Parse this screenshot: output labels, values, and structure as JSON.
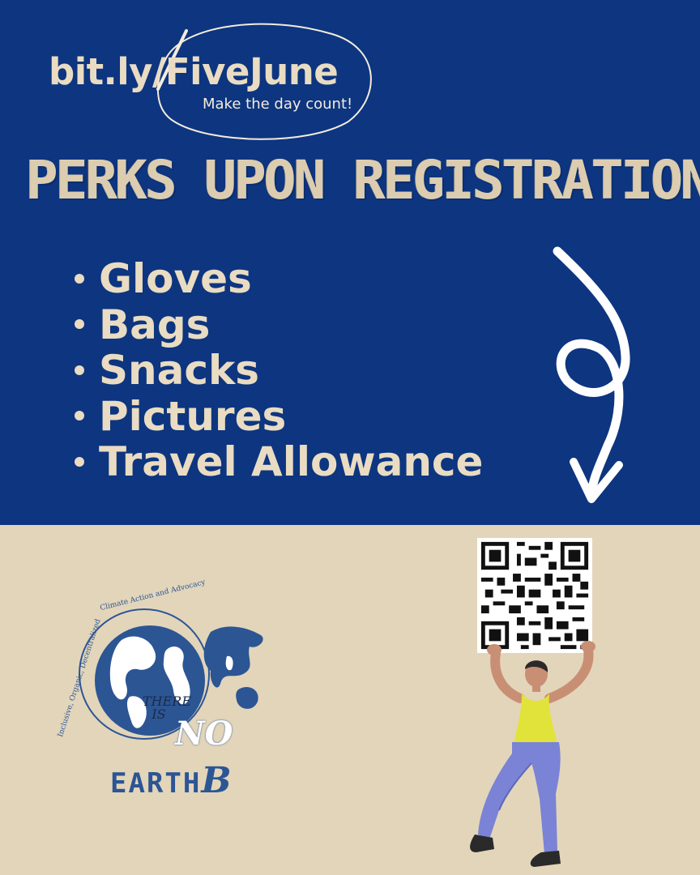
{
  "top_panel": {
    "link_text": "bit.ly/FiveJune",
    "tagline": "Make the day count!",
    "headline": "PERKS UPON REGISTRATION",
    "perks": [
      "Gloves",
      "Bags",
      "Snacks",
      "Pictures",
      "Travel Allowance"
    ]
  },
  "bottom_panel": {
    "logo": {
      "arc_text": "Climate Action and Advocacy",
      "side_text": "Inclusive, Organic, Decentralized",
      "there_is": "THERE IS",
      "no": "NO",
      "earth": "EARTH",
      "b": "B"
    },
    "qr_code_label": "QR code"
  },
  "colors": {
    "navy": "#0d3580",
    "cream": "#e2d5ba",
    "text_cream": "#e9dcc2",
    "logo_blue": "#2c5594",
    "shirt_yellow": "#e2e33a",
    "pants_purple": "#7a83d6"
  },
  "icons": [
    "curly-down-arrow-icon",
    "globe-icon",
    "qr-code-icon",
    "person-lifting-illustration"
  ]
}
